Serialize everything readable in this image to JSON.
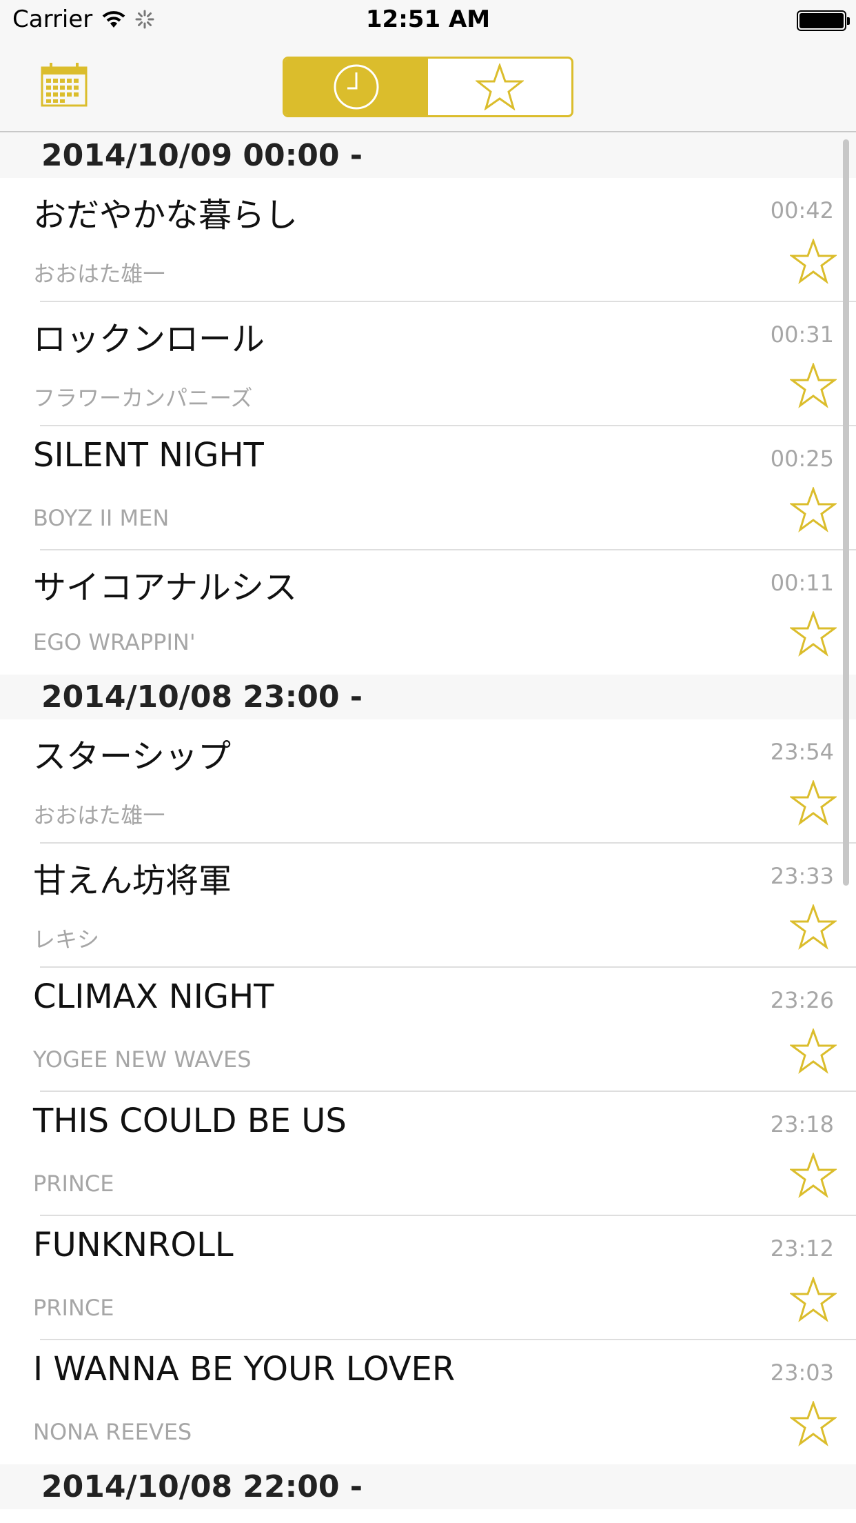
{
  "status_bar": {
    "carrier": "Carrier",
    "time": "12:51 AM"
  },
  "nav": {
    "calendar_icon": "calendar-icon",
    "tabs": [
      {
        "icon": "clock-icon",
        "selected": true
      },
      {
        "icon": "star-icon",
        "selected": false
      }
    ],
    "accent_color": "#dbbd2c"
  },
  "sections": [
    {
      "header": "2014/10/09 00:00 -",
      "items": [
        {
          "title": "おだやかな暮らし",
          "artist": "おおはた雄一",
          "time": "00:42"
        },
        {
          "title": "ロックンロール",
          "artist": "フラワーカンパニーズ",
          "time": "00:31"
        },
        {
          "title": "SILENT NIGHT",
          "artist": "BOYZ II MEN",
          "time": "00:25"
        },
        {
          "title": "サイコアナルシス",
          "artist": "EGO WRAPPIN'",
          "time": "00:11"
        }
      ]
    },
    {
      "header": "2014/10/08 23:00 -",
      "items": [
        {
          "title": "スターシップ",
          "artist": "おおはた雄一",
          "time": "23:54"
        },
        {
          "title": "甘えん坊将軍",
          "artist": "レキシ",
          "time": "23:33"
        },
        {
          "title": "CLIMAX NIGHT",
          "artist": "YOGEE NEW WAVES",
          "time": "23:26"
        },
        {
          "title": "THIS COULD BE US",
          "artist": "PRINCE",
          "time": "23:18"
        },
        {
          "title": "FUNKNROLL",
          "artist": "PRINCE",
          "time": "23:12"
        },
        {
          "title": "I WANNA BE YOUR LOVER",
          "artist": "NONA REEVES",
          "time": "23:03"
        }
      ]
    },
    {
      "header": "2014/10/08 22:00 -",
      "items": []
    }
  ]
}
